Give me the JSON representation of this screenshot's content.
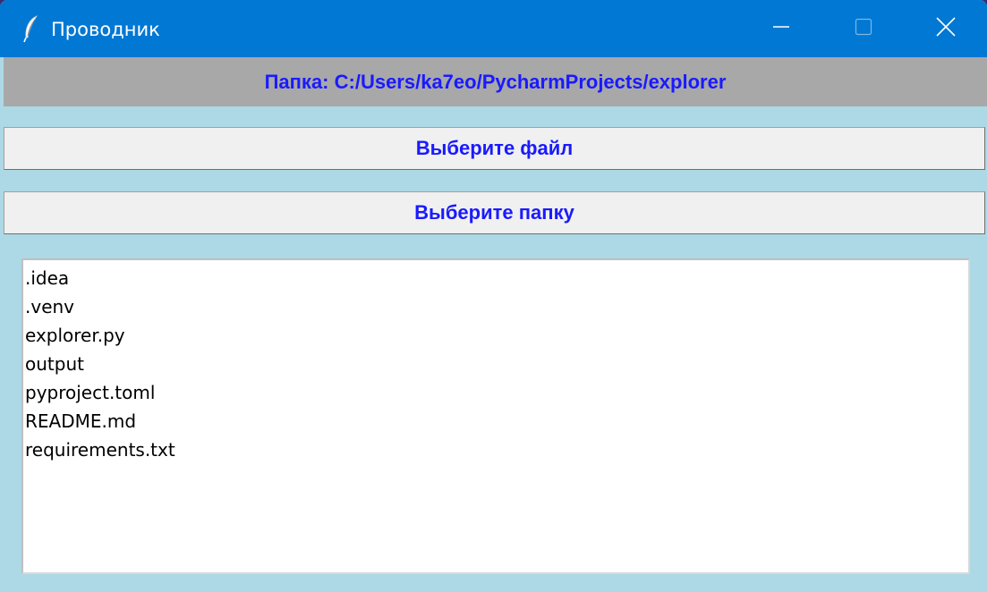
{
  "window": {
    "title": "Проводник",
    "icon": "feather-icon",
    "controls": [
      "minimize-icon",
      "maximize-icon",
      "close-icon"
    ]
  },
  "header": {
    "label": "Папка: C:/Users/ka7eo/PycharmProjects/explorer"
  },
  "buttons": {
    "select_file": "Выберите файл",
    "select_folder": "Выберите папку"
  },
  "file_list": {
    "items": [
      ".idea",
      ".venv",
      "explorer.py",
      "output",
      "pyproject.toml",
      "README.md",
      "requirements.txt"
    ]
  },
  "colors": {
    "titlebar": "#0078d4",
    "window_bg": "#add8e6",
    "header_bg": "#a8a8a8",
    "accent_text": "#1a1aff",
    "button_bg": "#f0f0f0"
  }
}
